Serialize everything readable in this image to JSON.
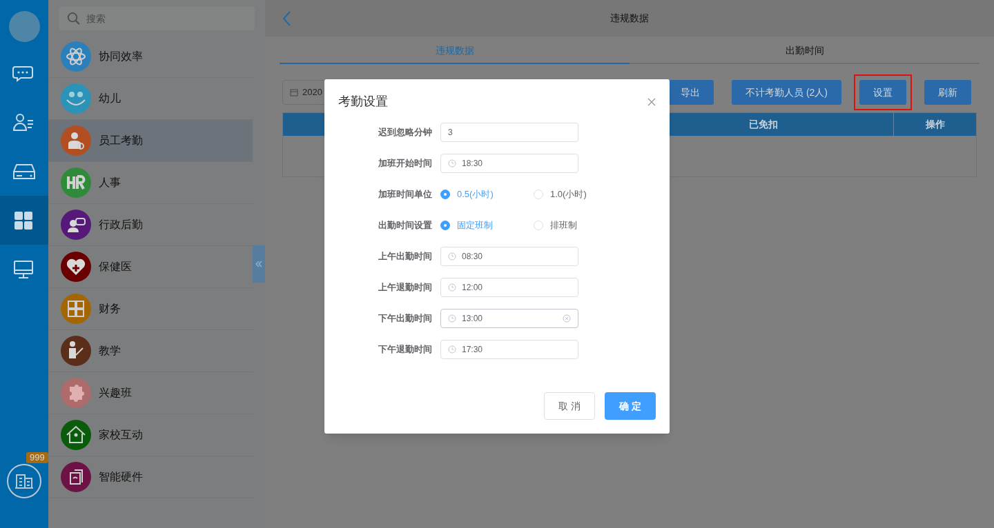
{
  "rail": {
    "items": [
      {
        "kind": "chat",
        "selected": false
      },
      {
        "kind": "contacts",
        "selected": false
      },
      {
        "kind": "drive",
        "selected": false
      },
      {
        "kind": "apps",
        "selected": true
      },
      {
        "kind": "desktop",
        "selected": false
      }
    ],
    "badge": "999"
  },
  "app_list": {
    "search": {
      "placeholder": "搜索"
    },
    "items": [
      {
        "label": "协同效率",
        "kind": "atom",
        "color": "#2b7fba",
        "selected": false
      },
      {
        "label": "幼儿",
        "kind": "smile",
        "color": "#2c93b8",
        "selected": false
      },
      {
        "label": "员工考勤",
        "kind": "staff",
        "color": "#b24e22",
        "selected": true
      },
      {
        "label": "人事",
        "kind": "hr",
        "color": "#2f8a3a",
        "selected": false
      },
      {
        "label": "行政后勤",
        "kind": "service",
        "color": "#56197a",
        "selected": false
      },
      {
        "label": "保健医",
        "kind": "heart",
        "color": "#6b0000",
        "selected": false
      },
      {
        "label": "财务",
        "kind": "calc",
        "color": "#a46600",
        "selected": false
      },
      {
        "label": "教学",
        "kind": "teacher",
        "color": "#5a2e18",
        "selected": false
      },
      {
        "label": "兴趣班",
        "kind": "puzzle",
        "color": "#ad6b6b",
        "selected": false
      },
      {
        "label": "家校互动",
        "kind": "house",
        "color": "#0a5c0a",
        "selected": false
      },
      {
        "label": "智能硬件",
        "kind": "device",
        "color": "#6c1244",
        "selected": false
      }
    ]
  },
  "main": {
    "title": "违规数据",
    "tabs": [
      {
        "label": "违规数据",
        "selected": true
      },
      {
        "label": "出勤时间",
        "selected": false
      }
    ],
    "date_field": {
      "value": "2020"
    },
    "buttons": [
      {
        "label": "导出",
        "highlighted": false
      },
      {
        "label": "不计考勤人员 (2人)",
        "highlighted": false
      },
      {
        "label": "设置",
        "highlighted": true
      },
      {
        "label": "刷新",
        "highlighted": false
      }
    ],
    "table": {
      "columns": [
        "已免扣",
        "操作"
      ]
    }
  },
  "dialog": {
    "title": "考勤设置",
    "fields": [
      {
        "kind": "text",
        "label": "迟到忽略分钟",
        "value": "3"
      },
      {
        "kind": "time",
        "label": "加班开始时间",
        "value": "18:30",
        "focused": false
      },
      {
        "kind": "radio",
        "label": "加班时间单位",
        "options": [
          {
            "label": "0.5(小时)",
            "selected": true
          },
          {
            "label": "1.0(小时)",
            "selected": false
          }
        ]
      },
      {
        "kind": "radio",
        "label": "出勤时间设置",
        "options": [
          {
            "label": "固定班制",
            "selected": true
          },
          {
            "label": "排班制",
            "selected": false
          }
        ]
      },
      {
        "kind": "time",
        "label": "上午出勤时间",
        "value": "08:30",
        "focused": false
      },
      {
        "kind": "time",
        "label": "上午退勤时间",
        "value": "12:00",
        "focused": false
      },
      {
        "kind": "time",
        "label": "下午出勤时间",
        "value": "13:00",
        "focused": true
      },
      {
        "kind": "time",
        "label": "下午退勤时间",
        "value": "17:30",
        "focused": false
      }
    ],
    "cancel": "取 消",
    "confirm": "确 定"
  }
}
